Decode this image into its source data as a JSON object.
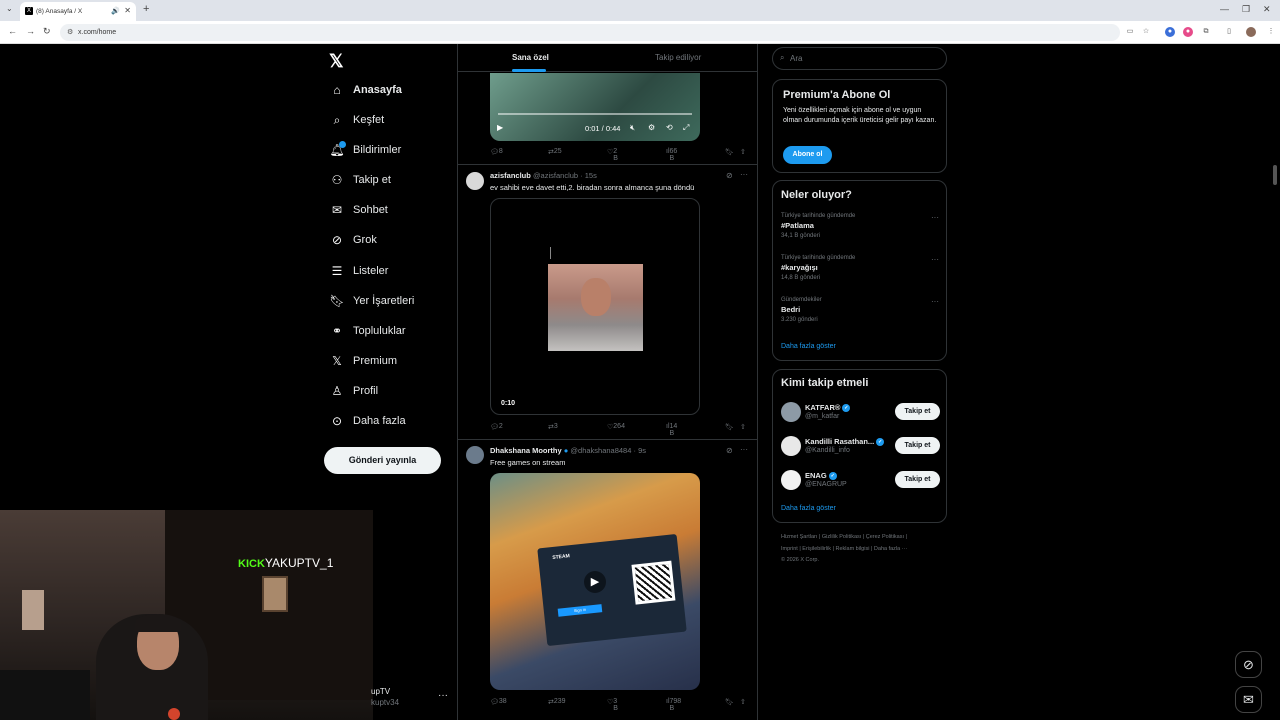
{
  "browser": {
    "tab_title": "(8) Anasayfa / X",
    "url": "x.com/home"
  },
  "nav": {
    "items": [
      {
        "label": "Anasayfa",
        "icon": "home-icon"
      },
      {
        "label": "Keşfet",
        "icon": "search-icon"
      },
      {
        "label": "Bildirimler",
        "icon": "bell-icon"
      },
      {
        "label": "Takip et",
        "icon": "person-add-icon"
      },
      {
        "label": "Sohbet",
        "icon": "mail-icon"
      },
      {
        "label": "Grok",
        "icon": "grok-icon"
      },
      {
        "label": "Listeler",
        "icon": "list-icon"
      },
      {
        "label": "Yer İşaretleri",
        "icon": "bookmark-icon"
      },
      {
        "label": "Topluluklar",
        "icon": "communities-icon"
      },
      {
        "label": "Premium",
        "icon": "x-icon"
      },
      {
        "label": "Profil",
        "icon": "profile-icon"
      },
      {
        "label": "Daha fazla",
        "icon": "more-icon"
      }
    ],
    "post_button": "Gönderi yayınla",
    "account_name": "upTV",
    "account_handle": "kuptv34"
  },
  "timeline": {
    "tab_for_you": "Sana özel",
    "tab_following": "Takip ediliyor",
    "posts": [
      {
        "video_time": "0:01 / 0:44",
        "replies": "8",
        "reposts": "25",
        "likes": "2 B",
        "views": "66 B"
      },
      {
        "name": "azisfanclub",
        "handle": "@azisfanclub · 15s",
        "text": "ev sahibi eve davet etti,2. biradan sonra almanca şuna döndü",
        "video_time": "0:10",
        "replies": "2",
        "reposts": "3",
        "likes": "264",
        "views": "14 B"
      },
      {
        "name": "Dhakshana Moorthy",
        "handle": "@dhakshana8484 · 9s",
        "text": "Free games on stream",
        "media_text": "STEAM",
        "media_button": "Sign in",
        "replies": "38",
        "reposts": "239",
        "likes": "3 B",
        "views": "798 B"
      }
    ]
  },
  "sidebar": {
    "search_placeholder": "Ara",
    "premium": {
      "title": "Premium'a Abone Ol",
      "desc": "Yeni özellikleri açmak için abone ol ve uygun olman durumunda içerik üreticisi gelir payı kazan.",
      "button": "Abone ol"
    },
    "trends": {
      "title": "Neler oluyor?",
      "items": [
        {
          "context": "Türkiye tarihinde gündemde",
          "name": "#Patlama",
          "count": "34,1 B gönderi"
        },
        {
          "context": "Türkiye tarihinde gündemde",
          "name": "#karyağışı",
          "count": "14,8 B gönderi"
        },
        {
          "context": "Gündemdekiler",
          "name": "Bedri",
          "count": "3.230 gönderi"
        }
      ],
      "show_more": "Daha fazla göster"
    },
    "who_to_follow": {
      "title": "Kimi takip etmeli",
      "items": [
        {
          "name": "KATFAR®",
          "handle": "@m_katfar"
        },
        {
          "name": "Kandilli Rasathan...",
          "handle": "@Kandilli_info"
        },
        {
          "name": "ENAG",
          "handle": "@ENAGRUP"
        }
      ],
      "follow_label": "Takip et",
      "show_more": "Daha fazla göster"
    },
    "footer": {
      "line1": "Hizmet Şartları  |  Gizlilik Politikası  |  Çerez Politikası  |",
      "line2": "Imprint  |  Erişilebilirlik  |  Reklam bilgisi  |  Daha fazla ···",
      "line3": "© 2026 X Corp."
    }
  },
  "overlay": {
    "kick_brand": "KICK",
    "channel": "YAKUPTV_1"
  }
}
